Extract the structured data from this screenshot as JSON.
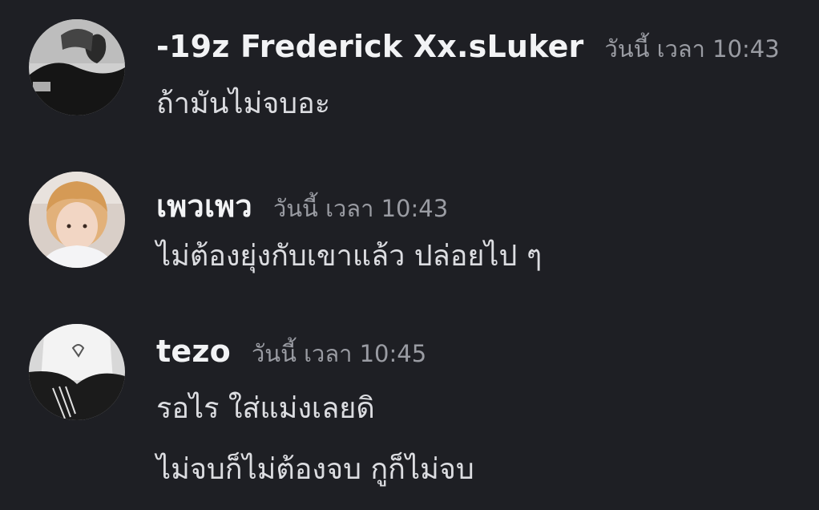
{
  "messages": [
    {
      "username": "-19z  Frederick Xx.sLuker",
      "timestamp": "วันนี้ เวลา 10:43",
      "lines": [
        "ถ้ามันไม่จบอะ"
      ],
      "avatar_icon": "user-avatar-bw-photo"
    },
    {
      "username": "เพวเพว",
      "timestamp": "วันนี้ เวลา 10:43",
      "lines": [
        "ไม่ต้องยุ่งกับเขาแล้ว ปล่อยไป ๆ"
      ],
      "avatar_icon": "user-avatar-color-photo"
    },
    {
      "username": "tezo",
      "timestamp": "วันนี้ เวลา 10:45",
      "lines": [
        "รอไร ใส่แม่งเลยดิ",
        "ไม่จบก็ไม่ต้องจบ กูก็ไม่จบ"
      ],
      "avatar_icon": "user-avatar-bw-photo"
    }
  ],
  "colors": {
    "background": "#1e1f24",
    "username": "#f2f3f5",
    "timestamp": "#9a9ca3",
    "message_text": "#dcdde1"
  }
}
